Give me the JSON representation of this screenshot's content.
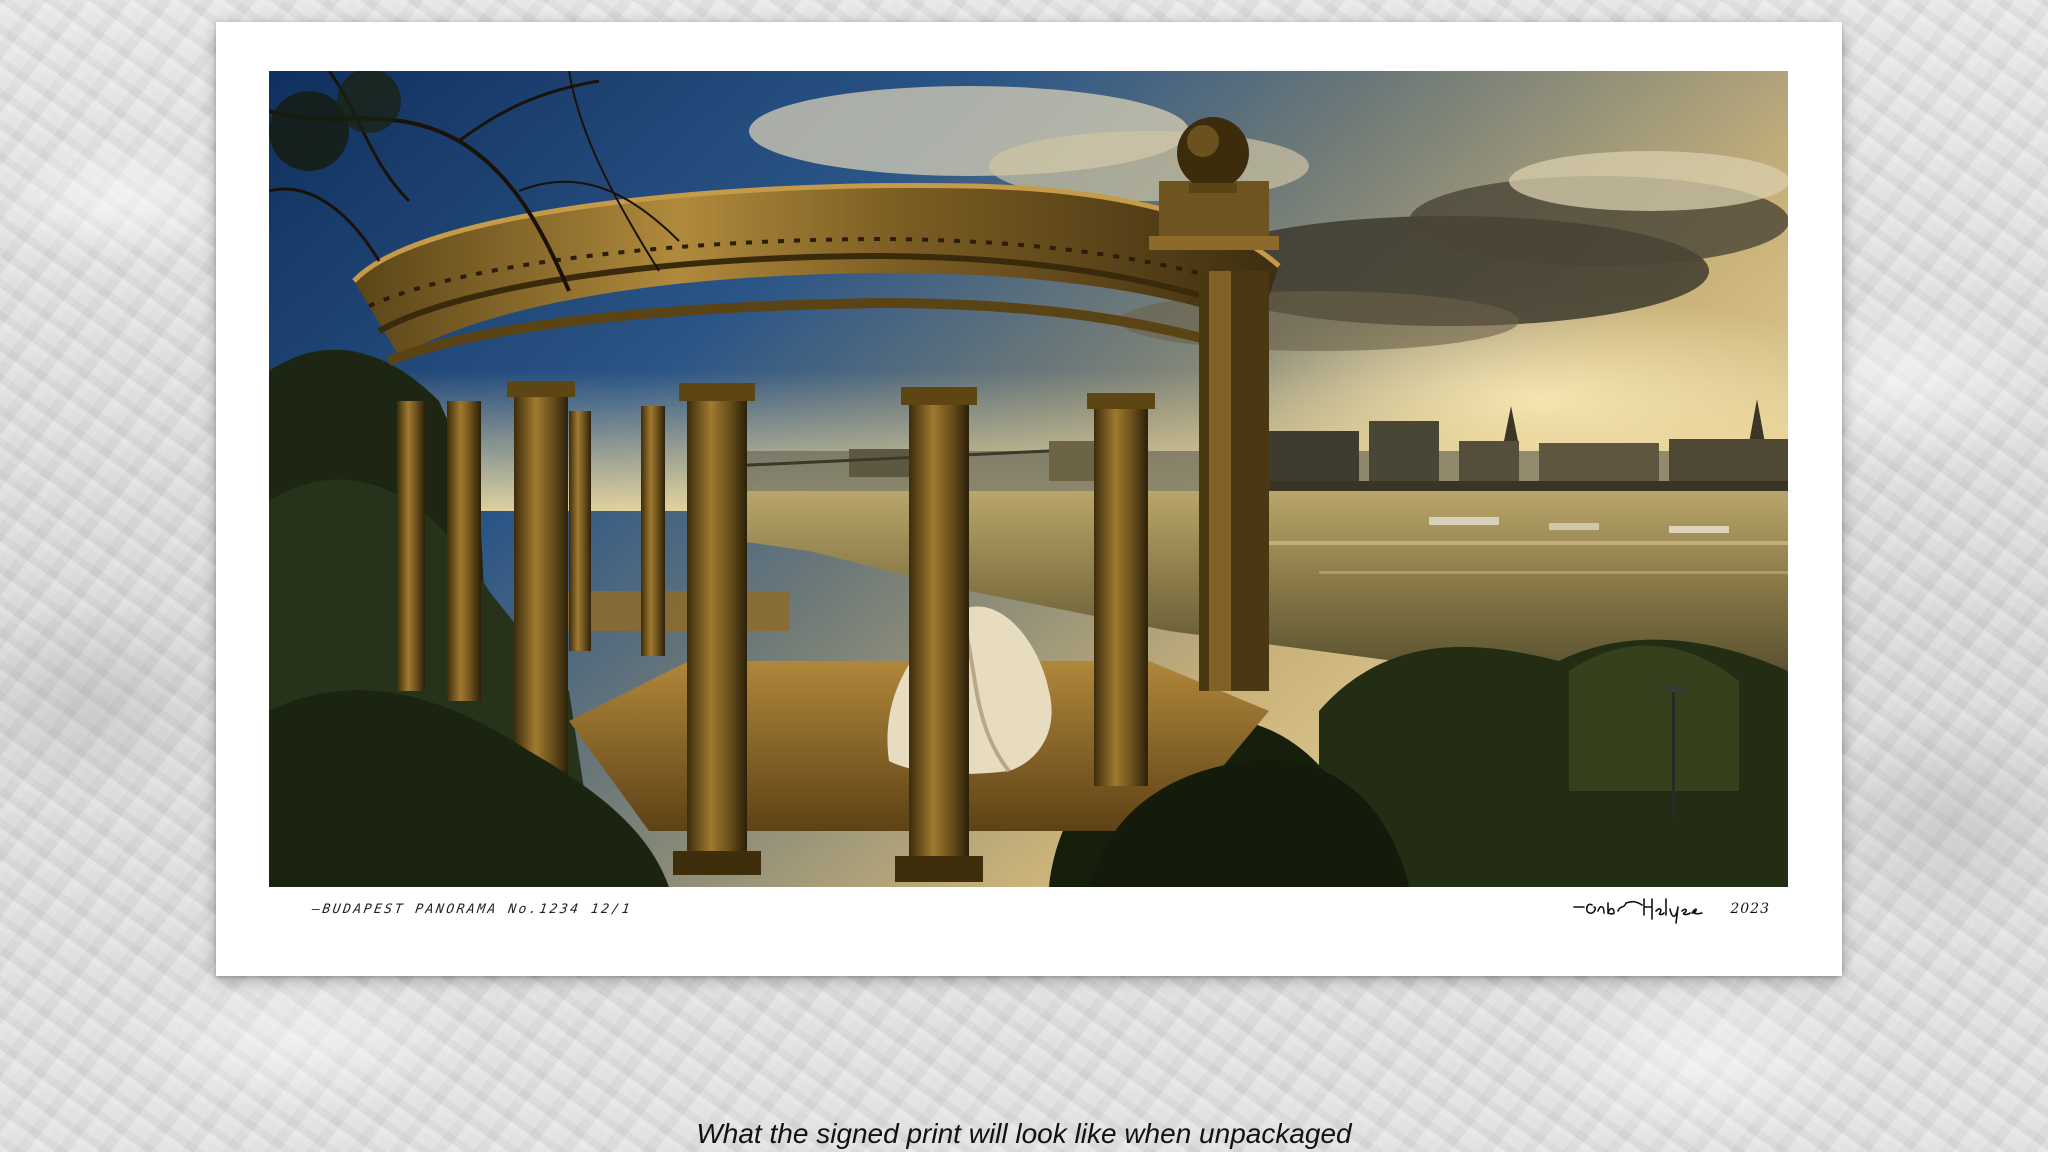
{
  "print": {
    "inscription": "—BUDAPEST PANORAMA No.1234 12/1",
    "signature_name": "Gabor Helyes",
    "signature_year": "2023"
  },
  "caption": "What the signed print will look like when unpackaged",
  "colors": {
    "sky_blue": "#1e3f6e",
    "sunset_gold": "#d9b060",
    "stone": "#8a6a2c",
    "river": "#9c8a52",
    "foliage": "#1f2a14"
  }
}
